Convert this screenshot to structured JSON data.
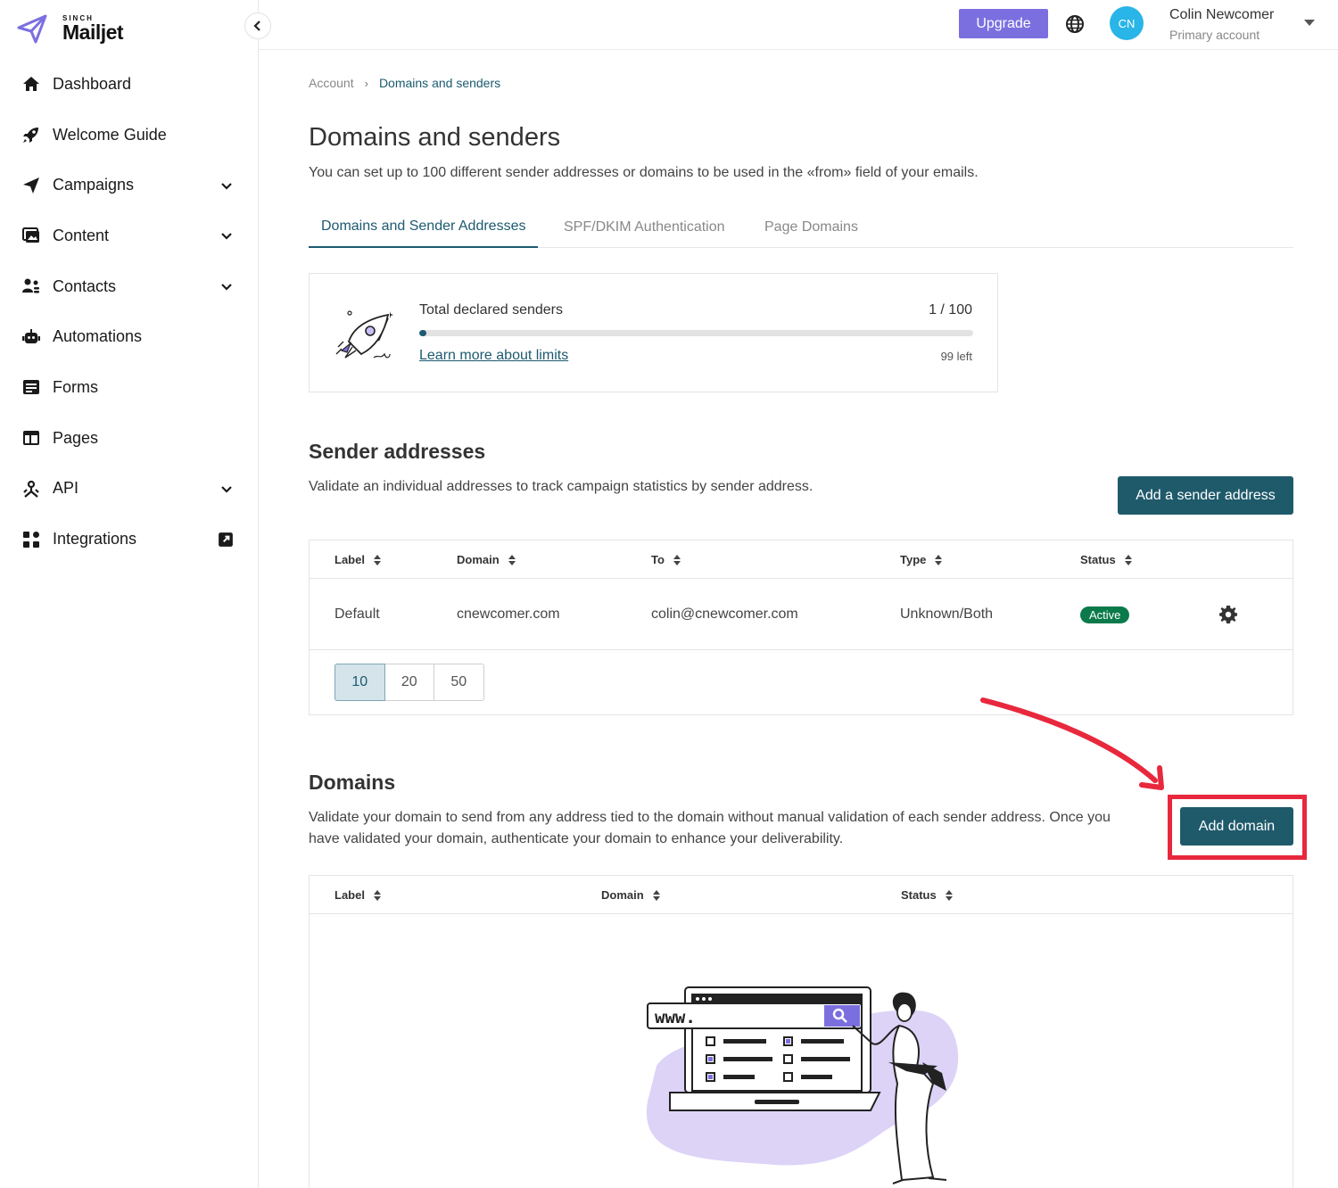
{
  "brand": {
    "sinch": "SINCH",
    "name": "Mailjet",
    "accent": "#7b6fe0"
  },
  "sidebar": {
    "items": [
      {
        "label": "Dashboard",
        "icon": "home-icon",
        "expandable": false
      },
      {
        "label": "Welcome Guide",
        "icon": "rocket-icon",
        "expandable": false
      },
      {
        "label": "Campaigns",
        "icon": "paper-plane-icon",
        "expandable": true
      },
      {
        "label": "Content",
        "icon": "image-gallery-icon",
        "expandable": true
      },
      {
        "label": "Contacts",
        "icon": "users-icon",
        "expandable": true
      },
      {
        "label": "Automations",
        "icon": "robot-icon",
        "expandable": false
      },
      {
        "label": "Forms",
        "icon": "form-icon",
        "expandable": false
      },
      {
        "label": "Pages",
        "icon": "layout-icon",
        "expandable": false
      },
      {
        "label": "API",
        "icon": "api-icon",
        "expandable": true
      },
      {
        "label": "Integrations",
        "icon": "grid-icon",
        "expandable": false,
        "external": true
      }
    ]
  },
  "topbar": {
    "upgrade_label": "Upgrade",
    "avatar_initials": "CN",
    "user_name": "Colin Newcomer",
    "user_role": "Primary account"
  },
  "breadcrumb": {
    "parent": "Account",
    "current": "Domains and senders"
  },
  "page": {
    "title": "Domains and senders",
    "description": "You can set up to 100 different sender addresses or domains to be used in the «from» field of your emails."
  },
  "tabs": [
    {
      "label": "Domains and Sender Addresses",
      "active": true
    },
    {
      "label": "SPF/DKIM Authentication",
      "active": false
    },
    {
      "label": "Page Domains",
      "active": false
    }
  ],
  "limits": {
    "title": "Total declared senders",
    "count": "1 / 100",
    "used": 1,
    "max": 100,
    "link": "Learn more about limits",
    "left": "99 left"
  },
  "senders": {
    "title": "Sender addresses",
    "description": "Validate an individual addresses to track campaign statistics by sender address.",
    "add_label": "Add a sender address",
    "columns": [
      "Label",
      "Domain",
      "To",
      "Type",
      "Status"
    ],
    "rows": [
      {
        "label": "Default",
        "domain": "cnewcomer.com",
        "to": "colin@cnewcomer.com",
        "type": "Unknown/Both",
        "status": "Active"
      }
    ],
    "page_sizes": [
      "10",
      "20",
      "50"
    ],
    "active_page_size": "10"
  },
  "domains": {
    "title": "Domains",
    "description": "Validate your domain to send from any address tied to the domain without manual validation of each sender address. Once you have validated your domain, authenticate your domain to enhance your deliverability.",
    "add_label": "Add domain",
    "columns": [
      "Label",
      "Domain",
      "Status"
    ],
    "illustration_text": "www."
  },
  "colors": {
    "primary": "#1f5a6b",
    "status_active": "#0b7a4b",
    "annotation": "#e8283d",
    "avatar": "#29b5e8"
  }
}
